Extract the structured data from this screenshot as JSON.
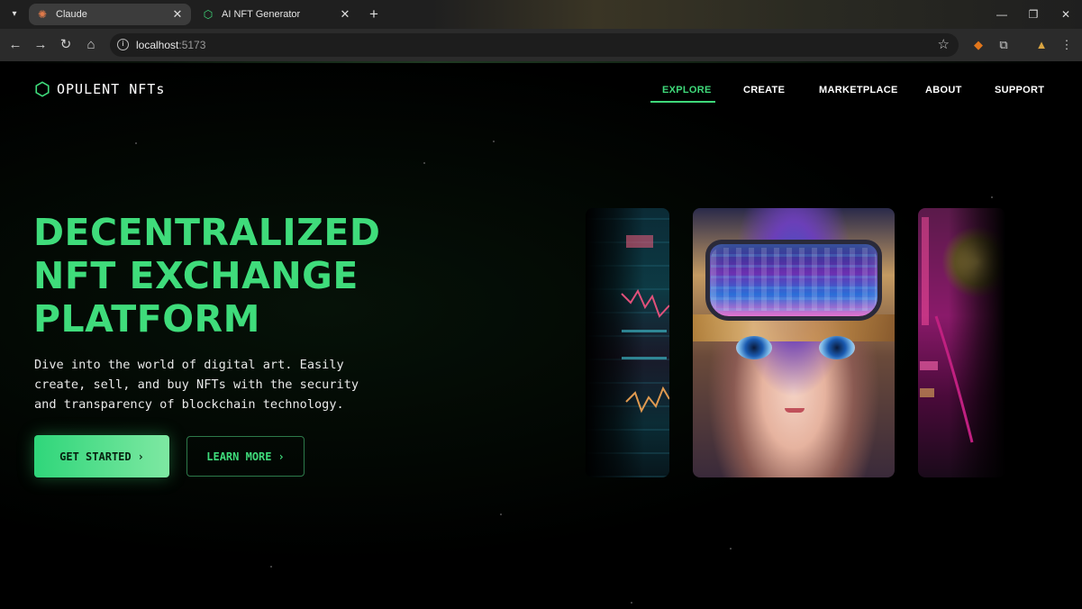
{
  "browser": {
    "tabs": [
      {
        "title": "Claude",
        "icon": "claude-icon",
        "active": true
      },
      {
        "title": "AI NFT Generator",
        "icon": "hexagon-icon",
        "active": false
      }
    ],
    "url_host": "localhost",
    "url_port": ":5173"
  },
  "site": {
    "logo_text": "OPULENT NFTs",
    "nav": [
      {
        "label": "EXPLORE",
        "active": true
      },
      {
        "label": "CREATE",
        "active": false
      },
      {
        "label": "MARKETPLACE",
        "active": false
      },
      {
        "label": "ABOUT",
        "active": false
      },
      {
        "label": "SUPPORT",
        "active": false
      }
    ]
  },
  "hero": {
    "headline_lines": [
      "DECENTRALIZED",
      "NFT EXCHANGE",
      "PLATFORM"
    ],
    "subtitle_lines": [
      "Dive into the world of digital art. Easily",
      "create, sell, and buy NFTs with the security",
      "and transparency of blockchain technology."
    ],
    "primary_button": "GET STARTED",
    "secondary_button": "LEARN MORE"
  },
  "colors": {
    "accent": "#3fdc7b",
    "background": "#000000"
  }
}
